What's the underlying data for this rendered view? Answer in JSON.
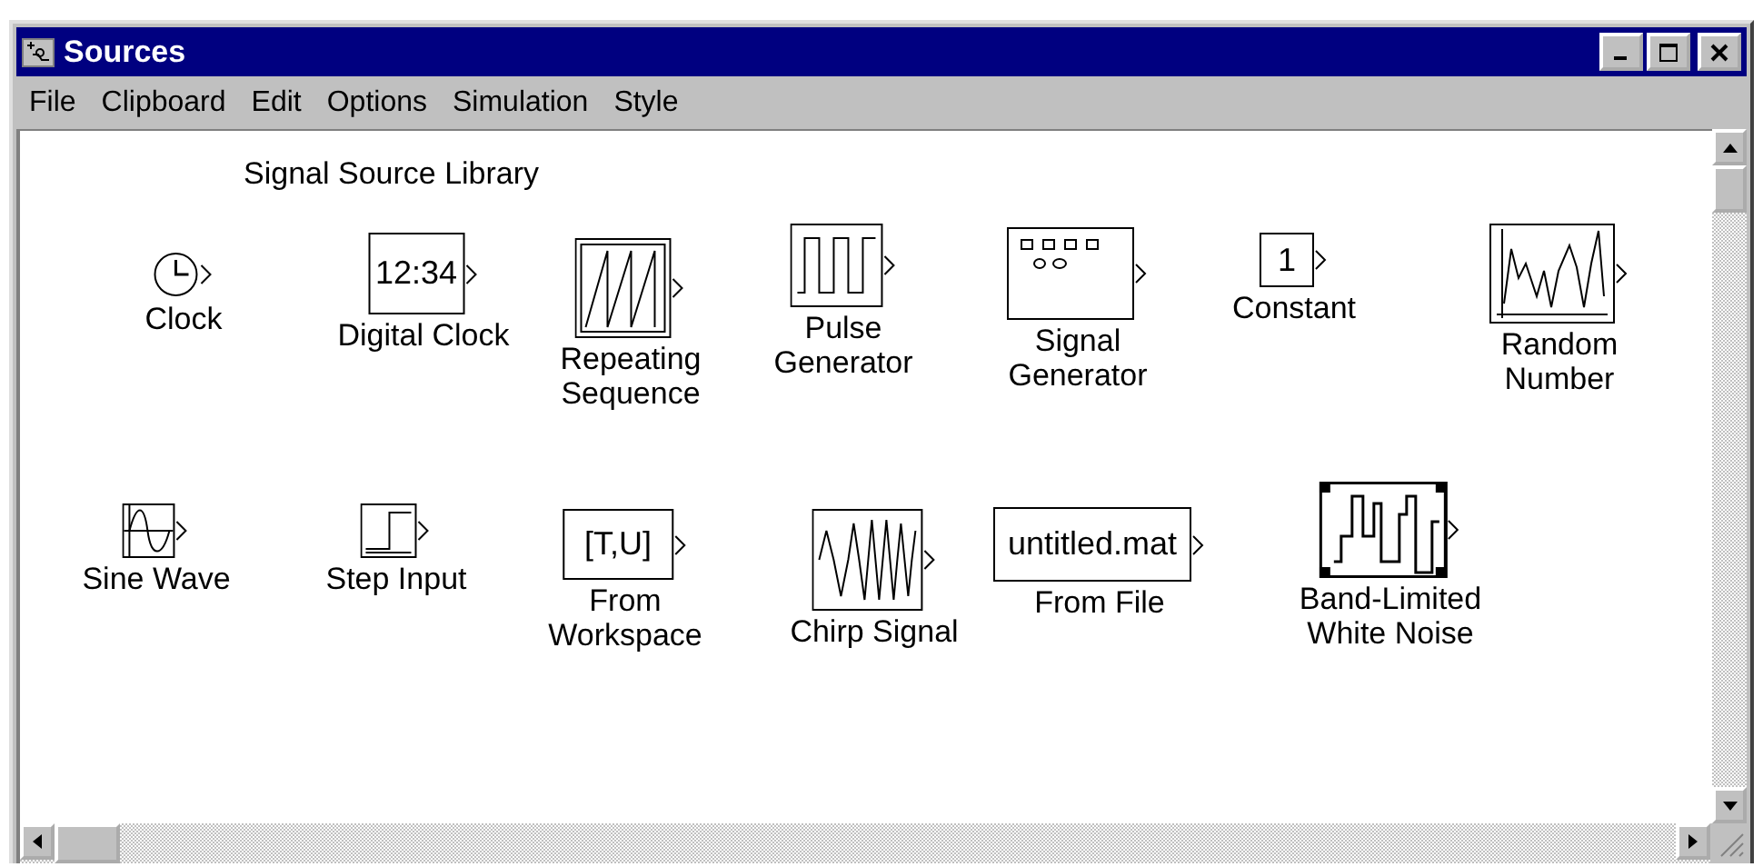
{
  "window": {
    "title": "Sources"
  },
  "menu": [
    "File",
    "Clipboard",
    "Edit",
    "Options",
    "Simulation",
    "Style"
  ],
  "library": {
    "title": "Signal Source Library",
    "blocks": [
      {
        "kind": "clock",
        "label": "Clock"
      },
      {
        "kind": "text",
        "text": "12:34",
        "label": "Digital Clock"
      },
      {
        "kind": "sawtooth",
        "label": "Repeating\nSequence"
      },
      {
        "kind": "pulse",
        "label": "Pulse\nGenerator"
      },
      {
        "kind": "signal-generator",
        "label": "Signal\nGenerator"
      },
      {
        "kind": "text",
        "text": "1",
        "label": "Constant"
      },
      {
        "kind": "random",
        "label": "Random\nNumber"
      },
      {
        "kind": "sine",
        "label": "Sine Wave"
      },
      {
        "kind": "step",
        "label": "Step Input"
      },
      {
        "kind": "text",
        "text": "[T,U]",
        "label": "From\nWorkspace"
      },
      {
        "kind": "chirp",
        "label": "Chirp Signal"
      },
      {
        "kind": "text",
        "text": "untitled.mat",
        "label": "From File"
      },
      {
        "kind": "noise",
        "label": "Band-Limited\nWhite Noise"
      }
    ]
  }
}
